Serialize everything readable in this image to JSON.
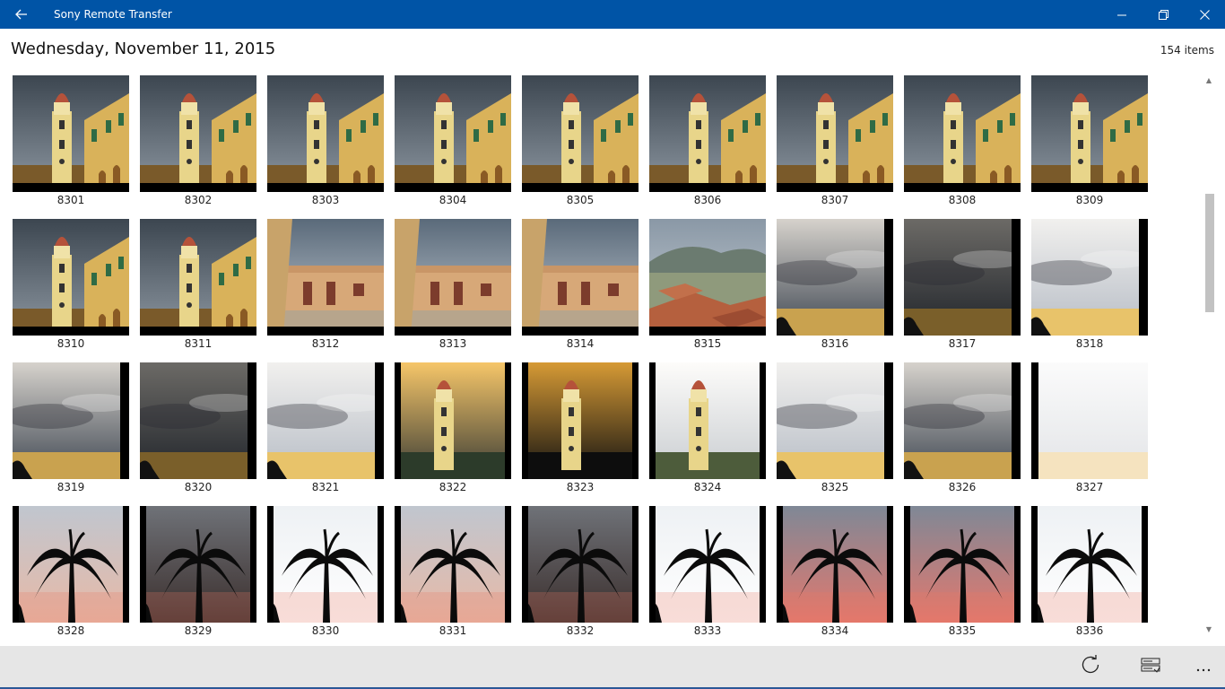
{
  "window": {
    "title": "Sony Remote Transfer"
  },
  "header": {
    "date": "Wednesday, November 11, 2015",
    "item_count": "154 items"
  },
  "colors": {
    "titlebar": "#0054a6",
    "appbar": "#e6e6e6",
    "scroll_thumb": "#c2c2c2"
  },
  "scrollbar": {
    "position_fraction": 0.2,
    "visible_fraction": 0.22
  },
  "icons": {
    "back": "back-arrow-icon",
    "minimize": "minimize-icon",
    "restore": "restore-icon",
    "close": "close-icon",
    "refresh": "refresh-icon",
    "select": "select-mode-icon",
    "more": "more-icon"
  },
  "photos": [
    {
      "label": "8301",
      "scene": "tower"
    },
    {
      "label": "8302",
      "scene": "tower"
    },
    {
      "label": "8303",
      "scene": "tower"
    },
    {
      "label": "8304",
      "scene": "tower"
    },
    {
      "label": "8305",
      "scene": "tower"
    },
    {
      "label": "8306",
      "scene": "tower"
    },
    {
      "label": "8307",
      "scene": "tower"
    },
    {
      "label": "8308",
      "scene": "tower"
    },
    {
      "label": "8309",
      "scene": "tower"
    },
    {
      "label": "8310",
      "scene": "tower"
    },
    {
      "label": "8311",
      "scene": "tower"
    },
    {
      "label": "8312",
      "scene": "street"
    },
    {
      "label": "8313",
      "scene": "street"
    },
    {
      "label": "8314",
      "scene": "street"
    },
    {
      "label": "8315",
      "scene": "rooftops"
    },
    {
      "label": "8316",
      "scene": "sky"
    },
    {
      "label": "8317",
      "scene": "sky-dark"
    },
    {
      "label": "8318",
      "scene": "sky-light"
    },
    {
      "label": "8319",
      "scene": "sky"
    },
    {
      "label": "8320",
      "scene": "sky-dark"
    },
    {
      "label": "8321",
      "scene": "sky-light"
    },
    {
      "label": "8322",
      "scene": "dusk-tower"
    },
    {
      "label": "8323",
      "scene": "dusk-tower-dark"
    },
    {
      "label": "8324",
      "scene": "day-tower"
    },
    {
      "label": "8325",
      "scene": "sky-light"
    },
    {
      "label": "8326",
      "scene": "sky"
    },
    {
      "label": "8327",
      "scene": "sky-white"
    },
    {
      "label": "8328",
      "scene": "palm"
    },
    {
      "label": "8329",
      "scene": "palm-dark"
    },
    {
      "label": "8330",
      "scene": "palm-light"
    },
    {
      "label": "8331",
      "scene": "palm"
    },
    {
      "label": "8332",
      "scene": "palm-dark"
    },
    {
      "label": "8333",
      "scene": "palm-light"
    },
    {
      "label": "8334",
      "scene": "palm-sunset"
    },
    {
      "label": "8335",
      "scene": "palm-sunset"
    },
    {
      "label": "8336",
      "scene": "palm-light"
    }
  ]
}
